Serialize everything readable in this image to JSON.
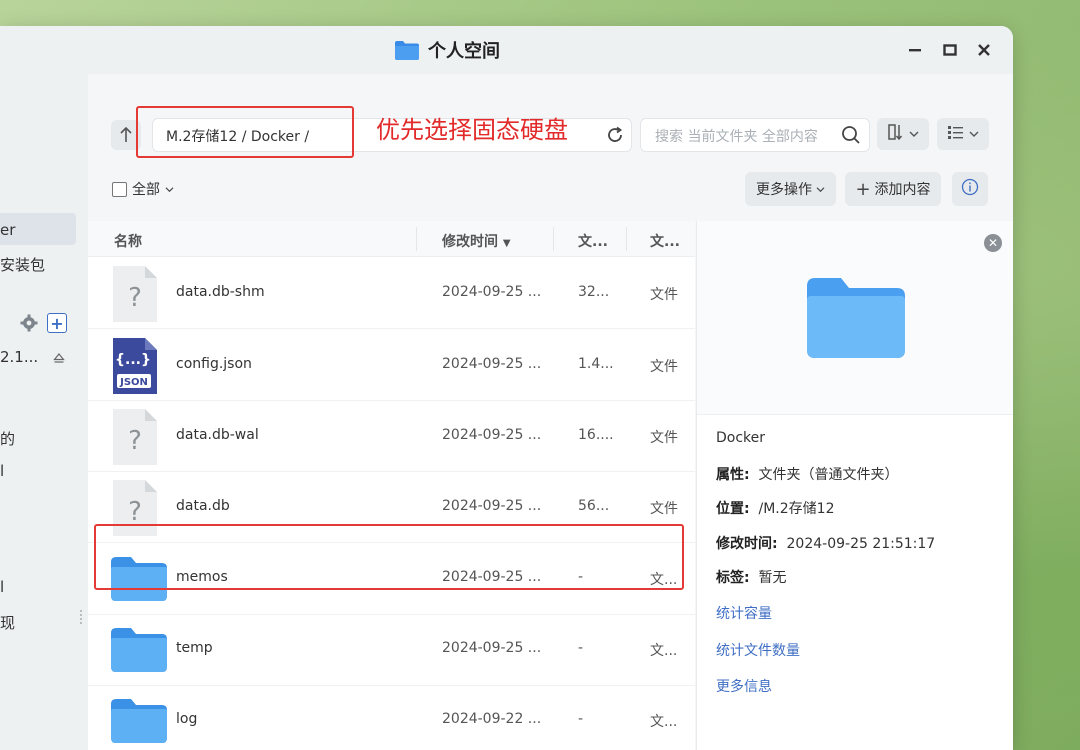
{
  "window": {
    "title": "个人空间",
    "controls": {
      "minimize": "–",
      "maximize": "□",
      "close": "✕"
    }
  },
  "sidebar": {
    "items": [
      {
        "label": "er",
        "active": true
      },
      {
        "label": "安装包"
      },
      {
        "label": "2.1..."
      },
      {
        "label": "的"
      },
      {
        "label": "l"
      },
      {
        "label": "l"
      },
      {
        "label": "现"
      }
    ]
  },
  "toolbar": {
    "path": "M.2存储12 / Docker /",
    "annotation": "优先选择固态硬盘",
    "search_placeholder": "搜索 当前文件夹 全部内容",
    "select_all": "全部",
    "more_actions": "更多操作",
    "add_content": "添加内容"
  },
  "list": {
    "headers": {
      "name": "名称",
      "modified": "修改时间",
      "size": "文...",
      "type": "文..."
    },
    "rows": [
      {
        "name": "data.db-shm",
        "modified": "2024-09-25 ...",
        "size": "32...",
        "type": "文件",
        "icon": "unknown-file-icon"
      },
      {
        "name": "config.json",
        "modified": "2024-09-25 ...",
        "size": "1.4...",
        "type": "文件",
        "icon": "json-file-icon"
      },
      {
        "name": "data.db-wal",
        "modified": "2024-09-25 ...",
        "size": "16....",
        "type": "文件",
        "icon": "unknown-file-icon"
      },
      {
        "name": "data.db",
        "modified": "2024-09-25 ...",
        "size": "56...",
        "type": "文件",
        "icon": "unknown-file-icon"
      },
      {
        "name": "memos",
        "modified": "2024-09-25 ...",
        "size": "-",
        "type": "文...",
        "icon": "folder-icon"
      },
      {
        "name": "temp",
        "modified": "2024-09-25 ...",
        "size": "-",
        "type": "文...",
        "icon": "folder-icon"
      },
      {
        "name": "log",
        "modified": "2024-09-22 ...",
        "size": "-",
        "type": "文...",
        "icon": "folder-icon"
      }
    ]
  },
  "detail": {
    "name": "Docker",
    "attr_label": "属性:",
    "attr_value": "文件夹（普通文件夹）",
    "location_label": "位置:",
    "location_value": "/M.2存储12",
    "modified_label": "修改时间:",
    "modified_value": "2024-09-25 21:51:17",
    "tags_label": "标签:",
    "tags_value": "暂无",
    "links": [
      "统计容量",
      "统计文件数量",
      "更多信息"
    ]
  },
  "colors": {
    "accent_link": "#3f6fc4",
    "annotation_red": "#e22a2a",
    "folder_blue": "#4aa3f0"
  }
}
